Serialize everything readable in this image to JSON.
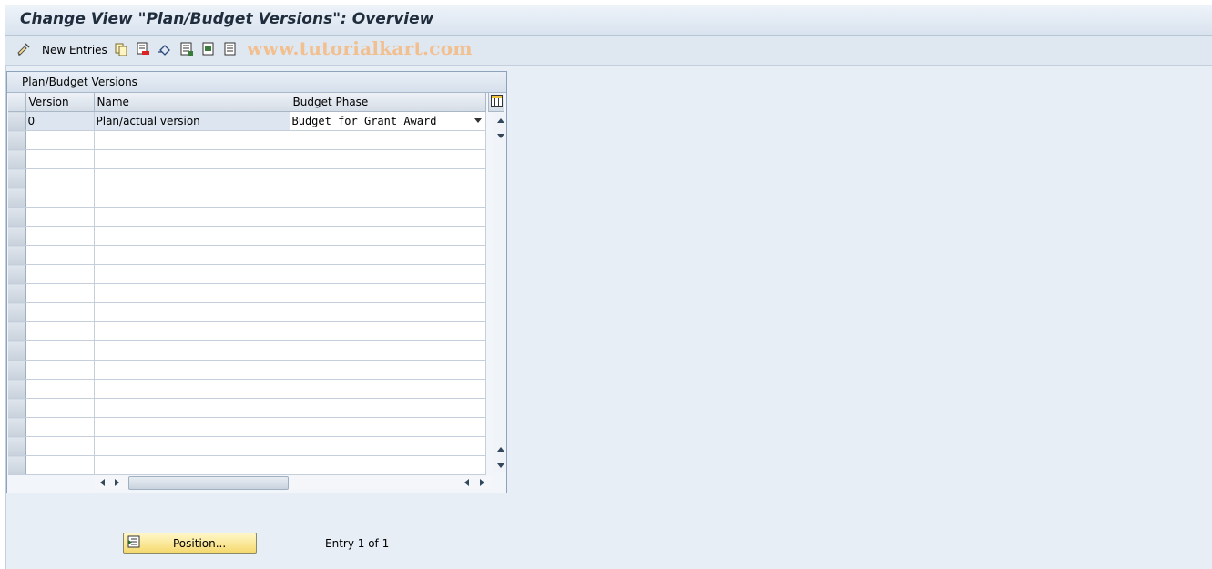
{
  "window": {
    "title": "Change View \"Plan/Budget Versions\": Overview"
  },
  "toolbar": {
    "new_entries_label": "New Entries",
    "watermark": "www.tutorialkart.com",
    "icons": [
      "display-change-icon",
      "copy-icon",
      "delete-icon",
      "undo-icon",
      "select-all-icon",
      "select-block-icon",
      "deselect-all-icon"
    ]
  },
  "panel": {
    "title": "Plan/Budget Versions",
    "columns": [
      "Version",
      "Name",
      "Budget Phase"
    ],
    "rows": [
      {
        "version": "0",
        "name": "Plan/actual version",
        "budget_phase": "Budget for Grant Award"
      }
    ]
  },
  "footer": {
    "position_button_label": "Position...",
    "entry_info": "Entry 1 of 1"
  },
  "colors": {
    "background": "#e8eef6",
    "position_button": "#f5d96f",
    "watermark": "#f2bf8f"
  }
}
